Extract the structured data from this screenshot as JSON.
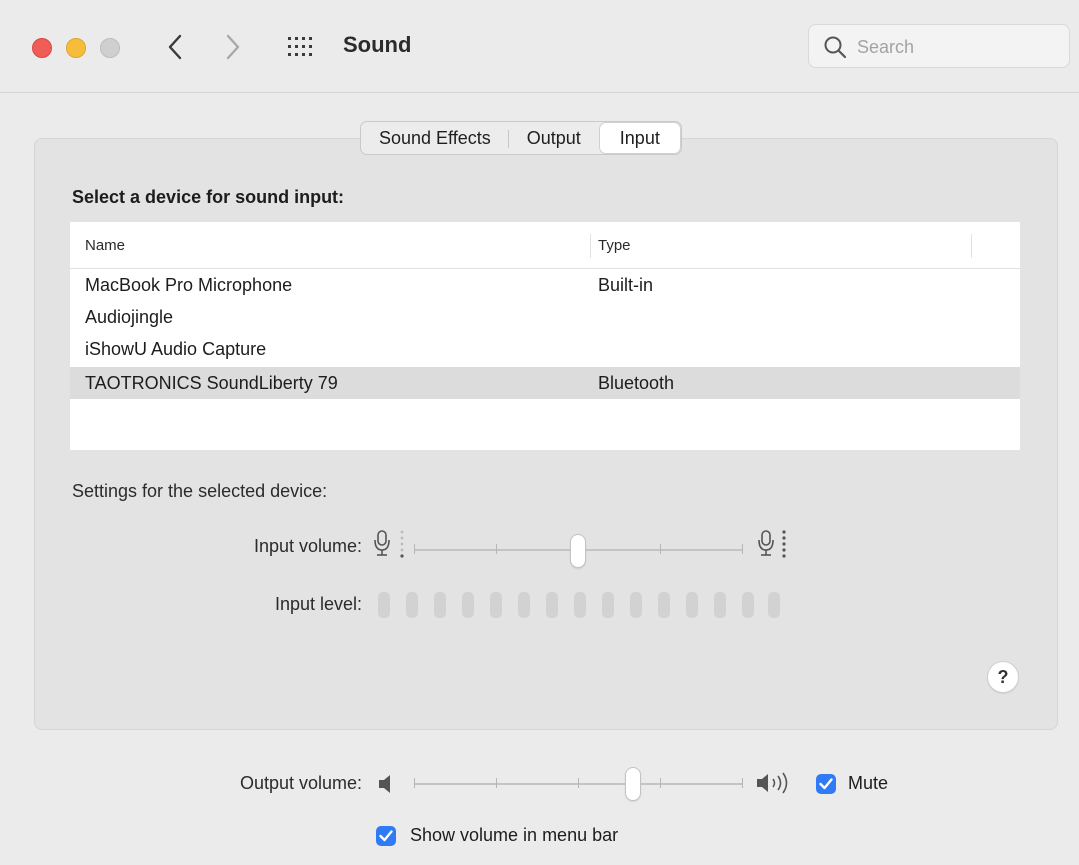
{
  "window": {
    "title": "Sound",
    "search_placeholder": "Search"
  },
  "tabs": [
    {
      "label": "Sound Effects",
      "active": false
    },
    {
      "label": "Output",
      "active": false
    },
    {
      "label": "Input",
      "active": true
    }
  ],
  "input": {
    "section_title": "Select a device for sound input:",
    "columns": {
      "name": "Name",
      "type": "Type"
    },
    "devices": [
      {
        "name": "MacBook Pro Microphone",
        "type": "Built-in",
        "selected": false
      },
      {
        "name": "Audiojingle",
        "type": "",
        "selected": false
      },
      {
        "name": "iShowU Audio Capture",
        "type": "",
        "selected": false
      },
      {
        "name": "TAOTRONICS SoundLiberty 79",
        "type": "Bluetooth",
        "selected": true
      }
    ],
    "settings_label": "Settings for the selected device:",
    "volume_label": "Input volume:",
    "volume_level": 0.5,
    "level_label": "Input level:",
    "level_segments": 15,
    "level_active": 0
  },
  "help_label": "?",
  "output": {
    "volume_label": "Output volume:",
    "volume_level": 0.67,
    "mute_label": "Mute",
    "mute_checked": true
  },
  "menu_bar": {
    "label": "Show volume in menu bar",
    "checked": true
  },
  "colors": {
    "accent": "#2f7bf5",
    "close": "#ee5d56",
    "minimize": "#f5bd3a",
    "maximize": "#cfcfcf"
  }
}
